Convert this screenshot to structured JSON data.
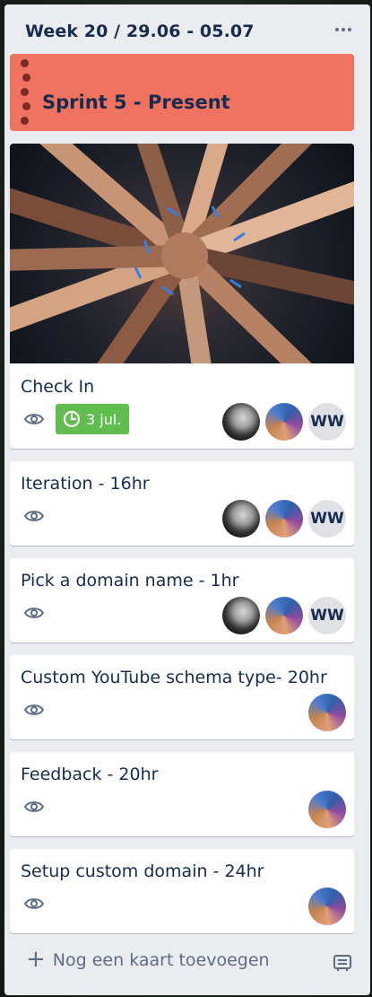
{
  "list": {
    "title": "Week 20 / 29.06 - 05.07",
    "menu_icon": "more-horizontal-icon"
  },
  "sprint_card": {
    "title": "Sprint 5 - Present",
    "color": "#f07260"
  },
  "cards": [
    {
      "title": "Check In",
      "cover": "photo-hands-together",
      "watch_icon": "eye-icon",
      "due": {
        "icon": "clock-icon",
        "label": "3 jul.",
        "color": "#61bd4f"
      },
      "members": [
        "avatar-gray",
        "avatar-color",
        "WW"
      ]
    },
    {
      "title": "Iteration - 16hr",
      "watch_icon": "eye-icon",
      "members": [
        "avatar-gray",
        "avatar-color",
        "WW"
      ]
    },
    {
      "title": "Pick a domain name - 1hr",
      "watch_icon": "eye-icon",
      "members": [
        "avatar-gray",
        "avatar-color",
        "WW"
      ]
    },
    {
      "title": "Custom YouTube schema type- 20hr",
      "watch_icon": "eye-icon",
      "members": [
        "avatar-color"
      ]
    },
    {
      "title": "Feedback - 20hr",
      "watch_icon": "eye-icon",
      "members": [
        "avatar-color"
      ]
    },
    {
      "title": "Setup custom domain - 24hr",
      "watch_icon": "eye-icon",
      "members": [
        "avatar-color"
      ]
    }
  ],
  "footer": {
    "add_card_label": "Nog een kaart toevoegen",
    "template_icon": "card-template-icon"
  }
}
